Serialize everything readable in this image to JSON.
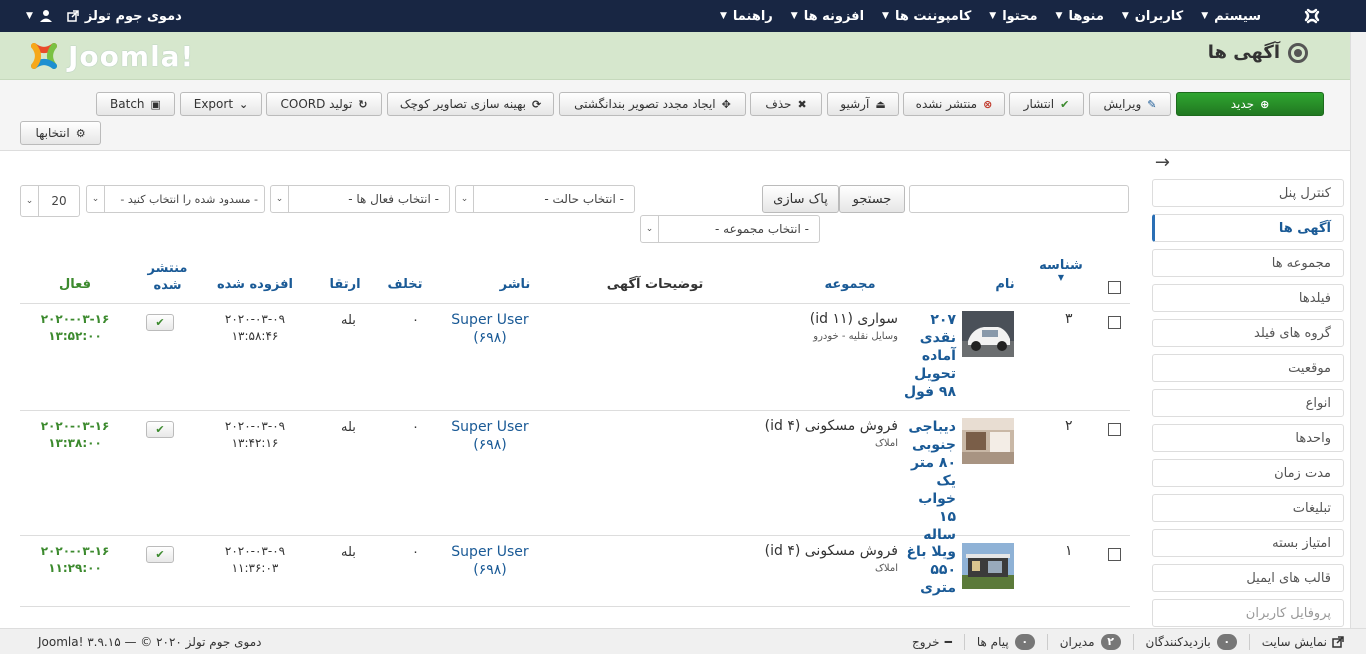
{
  "navbar": {
    "menu": [
      "سیستم",
      "کاربران",
      "منوها",
      "محتوا",
      "کامپوننت ها",
      "افزونه ها",
      "راهنما"
    ],
    "site_name": "دموی جوم تولز"
  },
  "header": {
    "title": "آگهی ها",
    "brand": "Joomla!"
  },
  "toolbar": {
    "new": "جدید",
    "edit": "ویرایش",
    "publish": "انتشار",
    "unpublish": "منتشر نشده",
    "archive": "آرشیو",
    "delete": "حذف",
    "regen_watermark": "ایجاد مجدد تصویر بندانگشتی",
    "optimize_thumbs": "بهینه سازی تصاویر کوچک",
    "coord": "تولید COORD",
    "export": "Export",
    "batch": "Batch",
    "options": "انتخابها"
  },
  "sidebar": {
    "items": [
      "کنترل پنل",
      "آگهی ها",
      "مجموعه ها",
      "فیلدها",
      "گروه های فیلد",
      "موقعیت",
      "انواع",
      "واحدها",
      "مدت زمان",
      "تبلیغات",
      "امتیاز بسته",
      "قالب های ایمیل",
      "پروفایل کاربران"
    ],
    "active_index": 1
  },
  "filters": {
    "search_button": "جستجو",
    "clear_button": "پاک سازی",
    "state": "- انتخاب حالت -",
    "active": "- انتخاب فعال ها -",
    "blocked": "- مسدود شده را انتخاب کنید -",
    "limit": "20",
    "category": "- انتخاب مجموعه -"
  },
  "table": {
    "headers": {
      "id": "شناسه",
      "name": "نام",
      "category": "مجموعه",
      "desc": "توضیحات آگهی",
      "publisher": "ناشر",
      "offense": "تخلف",
      "promote": "ارتقا",
      "added": "افزوده شده",
      "published_1": "منتشر",
      "published_2": "شده",
      "active": "فعال"
    },
    "rows": [
      {
        "id": "۳",
        "name": "۲۰۷ نقدی آماده تحویل ۹۸ فول",
        "category": "سواری (id ۱۱)",
        "category_sub": "وسایل نقلیه - خودرو",
        "publisher": "Super User",
        "publisher_id": "(۶۹۸)",
        "offense": "۰",
        "promote": "بله",
        "added_date": "۲۰۲۰-۰۳-۰۹",
        "added_time": "۱۳:۵۸:۴۶",
        "active_date": "۲۰۲۰-۰۳-۱۶",
        "active_time": "۱۳:۵۲:۰۰"
      },
      {
        "id": "۲",
        "name": "دیباجی جنوبی ۸۰ متر یک خواب ۱۵ ساله",
        "category": "فروش مسکونی (id ۴)",
        "category_sub": "املاک",
        "publisher": "Super User",
        "publisher_id": "(۶۹۸)",
        "offense": "۰",
        "promote": "بله",
        "added_date": "۲۰۲۰-۰۳-۰۹",
        "added_time": "۱۳:۴۲:۱۶",
        "active_date": "۲۰۲۰-۰۳-۱۶",
        "active_time": "۱۳:۳۸:۰۰"
      },
      {
        "id": "۱",
        "name": "ویلا باغ ۵۵۰ متری",
        "category": "فروش مسکونی (id ۴)",
        "category_sub": "املاک",
        "publisher": "Super User",
        "publisher_id": "(۶۹۸)",
        "offense": "۰",
        "promote": "بله",
        "added_date": "۲۰۲۰-۰۳-۰۹",
        "added_time": "۱۱:۳۶:۰۳",
        "active_date": "۲۰۲۰-۰۳-۱۶",
        "active_time": "۱۱:۲۹:۰۰"
      }
    ]
  },
  "footer": {
    "view_site": "نمایش سایت",
    "visitors_count": "۰",
    "visitors": "بازدیدکنندگان",
    "admins_count": "۲",
    "admins": "مدیران",
    "messages_count": "۰",
    "messages": "پیام ها",
    "logout": "خروج",
    "copyright": "دموی جوم تولز Joomla! ۳.۹.۱۵ — © ۲۰۲۰"
  }
}
